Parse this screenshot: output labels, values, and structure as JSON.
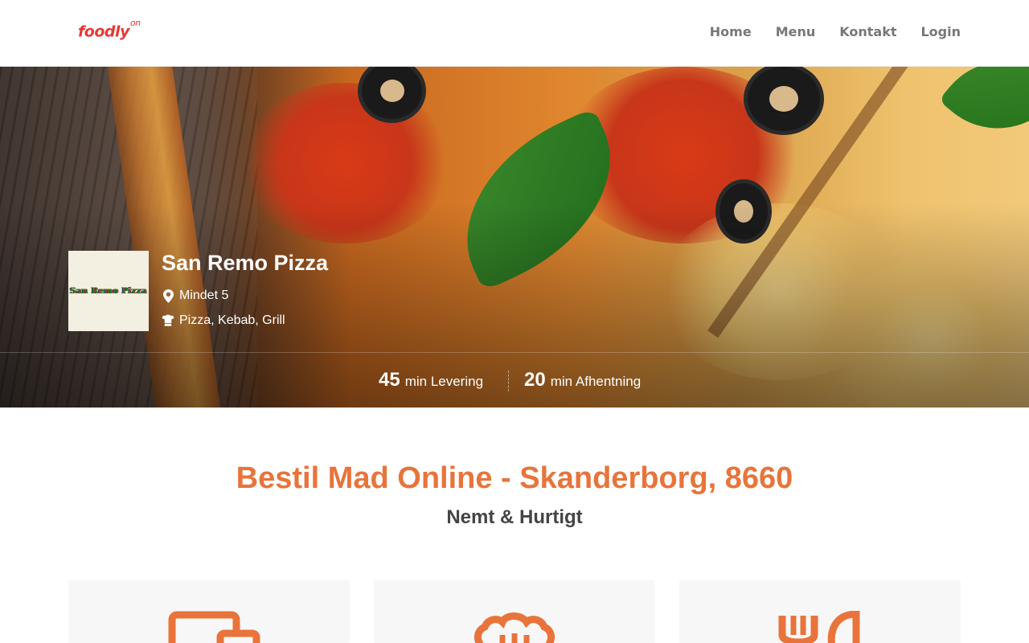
{
  "brand": {
    "name": "foodly",
    "suffix": "on",
    "color": "#e53935"
  },
  "nav": {
    "items": [
      "Home",
      "Menu",
      "Kontakt",
      "Login"
    ]
  },
  "restaurant": {
    "logo_text": "San Remo Pizza",
    "name": "San Remo Pizza",
    "address": "Mindet 5",
    "cuisine": "Pizza, Kebab, Grill",
    "address_icon": "map-marker-icon",
    "cuisine_icon": "chef-hat-icon"
  },
  "stats": {
    "delivery_minutes": "45",
    "delivery_label": "min Levering",
    "pickup_minutes": "20",
    "pickup_label": "min Afhentning"
  },
  "main": {
    "headline": "Bestil Mad Online - Skanderborg, 8660",
    "subheadline": "Nemt & Hurtigt",
    "accent_color": "#e8743b",
    "cards": [
      {
        "icon": "devices-icon"
      },
      {
        "icon": "chef-hat-icon"
      },
      {
        "icon": "cutlery-icon"
      }
    ]
  }
}
